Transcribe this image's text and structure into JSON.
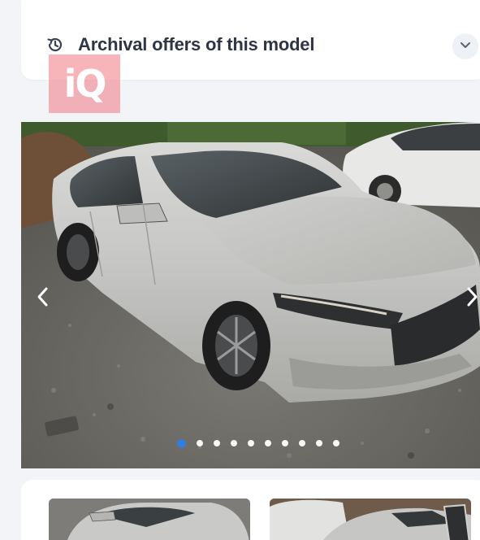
{
  "header": {
    "title": "Archival offers of this model",
    "icon": "history-icon",
    "toggle_icon": "chevron-down-icon"
  },
  "watermark": {
    "text": "iQ",
    "color": "#f07882"
  },
  "gallery": {
    "slide_count": 10,
    "active_index": 0,
    "active_dot_color": "#2f7de1",
    "prev_icon": "chevron-left-icon",
    "next_icon": "chevron-right-icon"
  },
  "thumbnails": [
    {
      "subject": "silver sedan front three-quarter view"
    },
    {
      "subject": "silver sedan with open door"
    }
  ]
}
